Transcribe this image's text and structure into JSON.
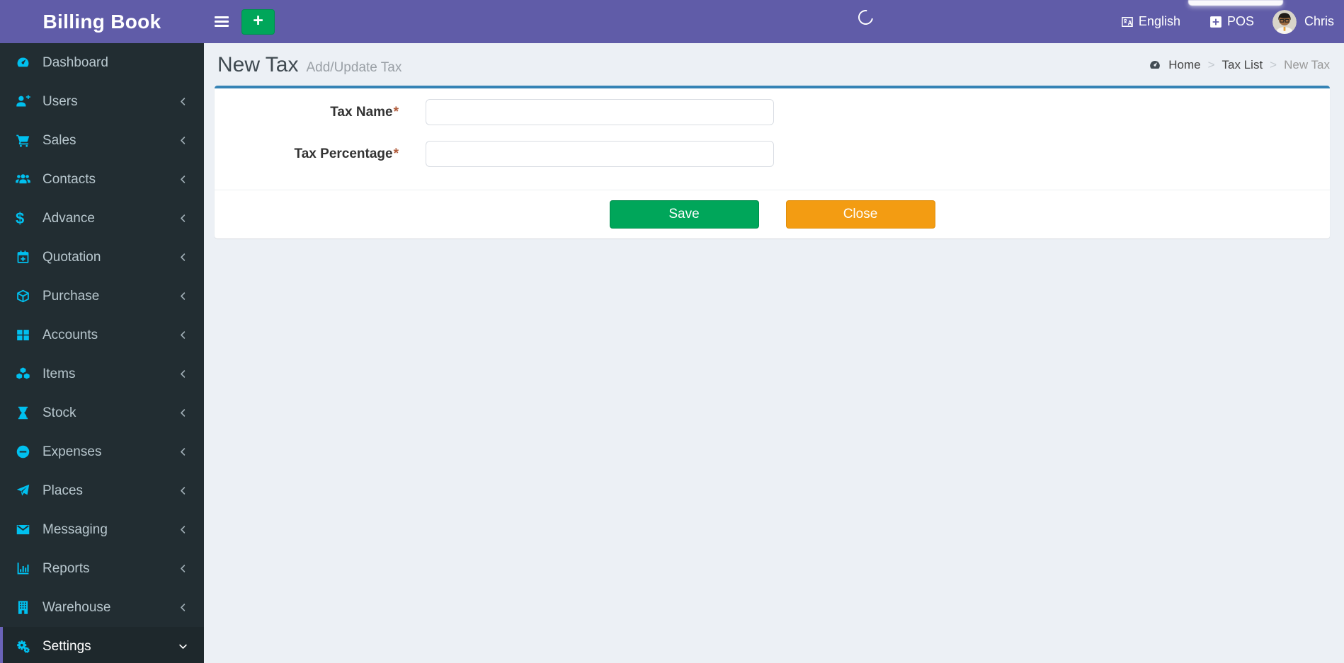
{
  "app": {
    "title": "Billing Book"
  },
  "topbar": {
    "menu_toggle_icon": "hamburger",
    "new_button_label": "+",
    "loading_spinner_visible": true,
    "language": {
      "icon": "language",
      "label": "English"
    },
    "pos": {
      "icon": "plus-square",
      "label": "POS"
    },
    "user": {
      "icon": "avatar",
      "name": "Chris"
    }
  },
  "sidebar": {
    "items": [
      {
        "label": "Dashboard",
        "icon": "dashboard",
        "has_submenu": false,
        "active": false
      },
      {
        "label": "Users",
        "icon": "user-plus",
        "has_submenu": true,
        "active": false
      },
      {
        "label": "Sales",
        "icon": "cart",
        "has_submenu": true,
        "active": false
      },
      {
        "label": "Contacts",
        "icon": "users",
        "has_submenu": true,
        "active": false
      },
      {
        "label": "Advance",
        "icon": "dollar",
        "glyph": "$",
        "has_submenu": true,
        "active": false
      },
      {
        "label": "Quotation",
        "icon": "calendar-plus",
        "has_submenu": true,
        "active": false
      },
      {
        "label": "Purchase",
        "icon": "cube",
        "has_submenu": true,
        "active": false
      },
      {
        "label": "Accounts",
        "icon": "th-large",
        "has_submenu": true,
        "active": false
      },
      {
        "label": "Items",
        "icon": "cubes",
        "has_submenu": true,
        "active": false
      },
      {
        "label": "Stock",
        "icon": "hourglass",
        "has_submenu": true,
        "active": false
      },
      {
        "label": "Expenses",
        "icon": "minus-circle",
        "has_submenu": true,
        "active": false
      },
      {
        "label": "Places",
        "icon": "paper-plane",
        "has_submenu": true,
        "active": false
      },
      {
        "label": "Messaging",
        "icon": "envelope",
        "has_submenu": true,
        "active": false
      },
      {
        "label": "Reports",
        "icon": "chart-bar",
        "has_submenu": true,
        "active": false
      },
      {
        "label": "Warehouse",
        "icon": "building",
        "has_submenu": true,
        "active": false
      },
      {
        "label": "Settings",
        "icon": "gears",
        "has_submenu": true,
        "active": true,
        "expanded": true
      }
    ]
  },
  "page": {
    "title": "New Tax",
    "subtitle": "Add/Update Tax",
    "breadcrumb_icon": "dashboard",
    "breadcrumb_separator": ">",
    "breadcrumb": [
      {
        "label": "Home",
        "active": false
      },
      {
        "label": "Tax List",
        "active": false
      },
      {
        "label": "New Tax",
        "active": true
      }
    ]
  },
  "form": {
    "required_marker": "*",
    "fields": [
      {
        "label": "Tax Name",
        "required": true,
        "value": "",
        "placeholder": ""
      },
      {
        "label": "Tax Percentage",
        "required": true,
        "value": "",
        "placeholder": ""
      }
    ],
    "buttons": {
      "save": "Save",
      "close": "Close"
    }
  },
  "colors": {
    "header_purple": "#605ca8",
    "sidebar_dark": "#222d32",
    "sidebar_active_bg": "#1e282c",
    "sidebar_active_border": "#6a63b8",
    "icon_cyan": "#00c0ef",
    "sidebar_text": "#b8c7ce",
    "content_bg": "#ecf0f5",
    "panel_top_border": "#3583b5",
    "save_green": "#00a65a",
    "close_orange": "#f39c12",
    "required_asterisk": "#b05c3c"
  }
}
